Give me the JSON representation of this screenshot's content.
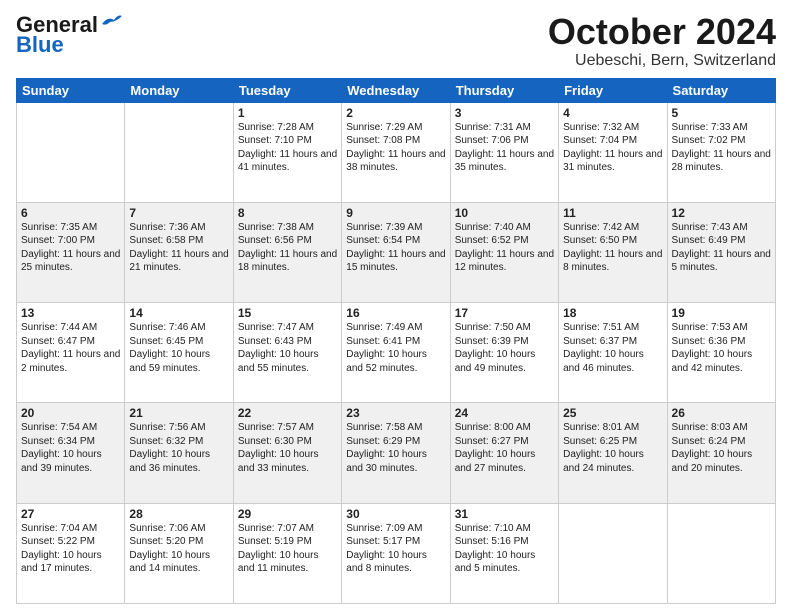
{
  "header": {
    "logo_line1": "General",
    "logo_line2": "Blue",
    "title": "October 2024",
    "subtitle": "Uebeschi, Bern, Switzerland"
  },
  "days_of_week": [
    "Sunday",
    "Monday",
    "Tuesday",
    "Wednesday",
    "Thursday",
    "Friday",
    "Saturday"
  ],
  "weeks": [
    [
      {
        "day": "",
        "info": ""
      },
      {
        "day": "",
        "info": ""
      },
      {
        "day": "1",
        "info": "Sunrise: 7:28 AM\nSunset: 7:10 PM\nDaylight: 11 hours and 41 minutes."
      },
      {
        "day": "2",
        "info": "Sunrise: 7:29 AM\nSunset: 7:08 PM\nDaylight: 11 hours and 38 minutes."
      },
      {
        "day": "3",
        "info": "Sunrise: 7:31 AM\nSunset: 7:06 PM\nDaylight: 11 hours and 35 minutes."
      },
      {
        "day": "4",
        "info": "Sunrise: 7:32 AM\nSunset: 7:04 PM\nDaylight: 11 hours and 31 minutes."
      },
      {
        "day": "5",
        "info": "Sunrise: 7:33 AM\nSunset: 7:02 PM\nDaylight: 11 hours and 28 minutes."
      }
    ],
    [
      {
        "day": "6",
        "info": "Sunrise: 7:35 AM\nSunset: 7:00 PM\nDaylight: 11 hours and 25 minutes."
      },
      {
        "day": "7",
        "info": "Sunrise: 7:36 AM\nSunset: 6:58 PM\nDaylight: 11 hours and 21 minutes."
      },
      {
        "day": "8",
        "info": "Sunrise: 7:38 AM\nSunset: 6:56 PM\nDaylight: 11 hours and 18 minutes."
      },
      {
        "day": "9",
        "info": "Sunrise: 7:39 AM\nSunset: 6:54 PM\nDaylight: 11 hours and 15 minutes."
      },
      {
        "day": "10",
        "info": "Sunrise: 7:40 AM\nSunset: 6:52 PM\nDaylight: 11 hours and 12 minutes."
      },
      {
        "day": "11",
        "info": "Sunrise: 7:42 AM\nSunset: 6:50 PM\nDaylight: 11 hours and 8 minutes."
      },
      {
        "day": "12",
        "info": "Sunrise: 7:43 AM\nSunset: 6:49 PM\nDaylight: 11 hours and 5 minutes."
      }
    ],
    [
      {
        "day": "13",
        "info": "Sunrise: 7:44 AM\nSunset: 6:47 PM\nDaylight: 11 hours and 2 minutes."
      },
      {
        "day": "14",
        "info": "Sunrise: 7:46 AM\nSunset: 6:45 PM\nDaylight: 10 hours and 59 minutes."
      },
      {
        "day": "15",
        "info": "Sunrise: 7:47 AM\nSunset: 6:43 PM\nDaylight: 10 hours and 55 minutes."
      },
      {
        "day": "16",
        "info": "Sunrise: 7:49 AM\nSunset: 6:41 PM\nDaylight: 10 hours and 52 minutes."
      },
      {
        "day": "17",
        "info": "Sunrise: 7:50 AM\nSunset: 6:39 PM\nDaylight: 10 hours and 49 minutes."
      },
      {
        "day": "18",
        "info": "Sunrise: 7:51 AM\nSunset: 6:37 PM\nDaylight: 10 hours and 46 minutes."
      },
      {
        "day": "19",
        "info": "Sunrise: 7:53 AM\nSunset: 6:36 PM\nDaylight: 10 hours and 42 minutes."
      }
    ],
    [
      {
        "day": "20",
        "info": "Sunrise: 7:54 AM\nSunset: 6:34 PM\nDaylight: 10 hours and 39 minutes."
      },
      {
        "day": "21",
        "info": "Sunrise: 7:56 AM\nSunset: 6:32 PM\nDaylight: 10 hours and 36 minutes."
      },
      {
        "day": "22",
        "info": "Sunrise: 7:57 AM\nSunset: 6:30 PM\nDaylight: 10 hours and 33 minutes."
      },
      {
        "day": "23",
        "info": "Sunrise: 7:58 AM\nSunset: 6:29 PM\nDaylight: 10 hours and 30 minutes."
      },
      {
        "day": "24",
        "info": "Sunrise: 8:00 AM\nSunset: 6:27 PM\nDaylight: 10 hours and 27 minutes."
      },
      {
        "day": "25",
        "info": "Sunrise: 8:01 AM\nSunset: 6:25 PM\nDaylight: 10 hours and 24 minutes."
      },
      {
        "day": "26",
        "info": "Sunrise: 8:03 AM\nSunset: 6:24 PM\nDaylight: 10 hours and 20 minutes."
      }
    ],
    [
      {
        "day": "27",
        "info": "Sunrise: 7:04 AM\nSunset: 5:22 PM\nDaylight: 10 hours and 17 minutes."
      },
      {
        "day": "28",
        "info": "Sunrise: 7:06 AM\nSunset: 5:20 PM\nDaylight: 10 hours and 14 minutes."
      },
      {
        "day": "29",
        "info": "Sunrise: 7:07 AM\nSunset: 5:19 PM\nDaylight: 10 hours and 11 minutes."
      },
      {
        "day": "30",
        "info": "Sunrise: 7:09 AM\nSunset: 5:17 PM\nDaylight: 10 hours and 8 minutes."
      },
      {
        "day": "31",
        "info": "Sunrise: 7:10 AM\nSunset: 5:16 PM\nDaylight: 10 hours and 5 minutes."
      },
      {
        "day": "",
        "info": ""
      },
      {
        "day": "",
        "info": ""
      }
    ]
  ]
}
